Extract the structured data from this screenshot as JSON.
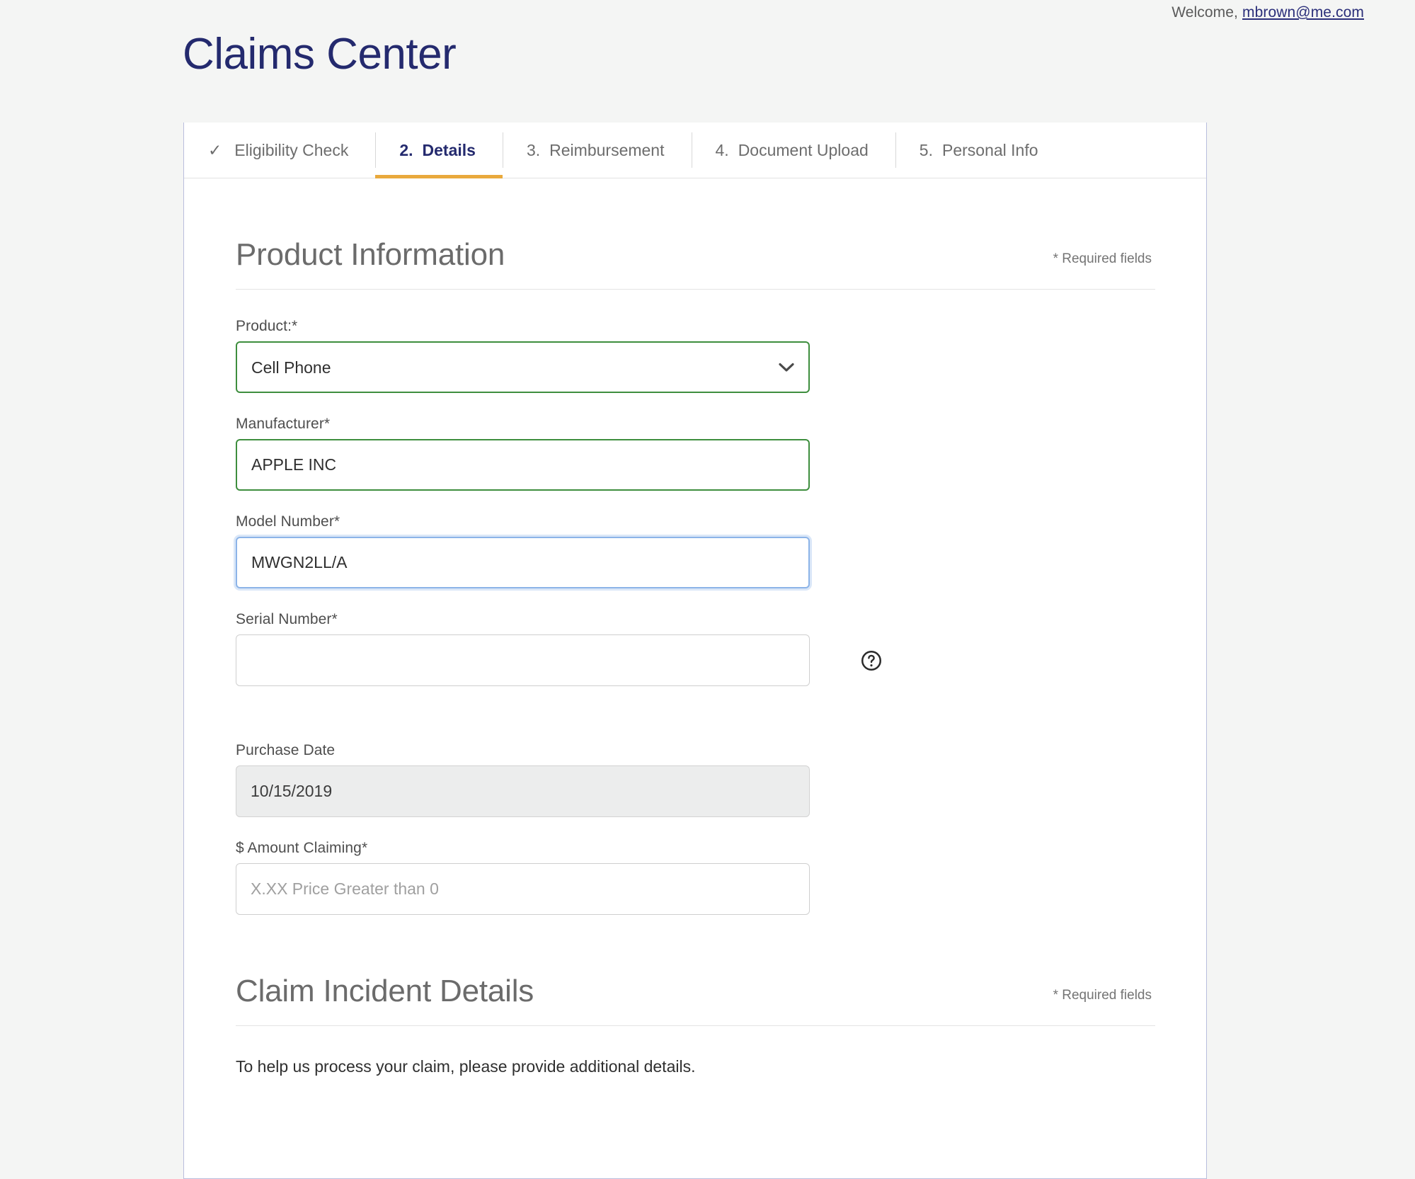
{
  "header": {
    "welcome_label": "Welcome,",
    "welcome_email": "mbrown@me.com",
    "page_title": "Claims Center"
  },
  "tabs": [
    {
      "num": "",
      "label": "Eligibility Check",
      "state": "complete",
      "check_icon": "✓"
    },
    {
      "num": "2.",
      "label": "Details",
      "state": "active"
    },
    {
      "num": "3.",
      "label": "Reimbursement",
      "state": "upcoming"
    },
    {
      "num": "4.",
      "label": "Document Upload",
      "state": "upcoming"
    },
    {
      "num": "5.",
      "label": "Personal Info",
      "state": "upcoming"
    }
  ],
  "product_section": {
    "title": "Product Information",
    "required_note": "* Required fields",
    "fields": {
      "product": {
        "label": "Product:*",
        "value": "Cell Phone",
        "options": [
          "Cell Phone"
        ]
      },
      "manufacturer": {
        "label": "Manufacturer*",
        "value": "APPLE INC"
      },
      "model_number": {
        "label": "Model Number*",
        "value": "MWGN2LL/A"
      },
      "serial_number": {
        "label": "Serial Number*",
        "value": "",
        "placeholder": ""
      },
      "purchase_date": {
        "label": "Purchase Date",
        "value": "10/15/2019"
      },
      "amount_claiming": {
        "label": "$ Amount Claiming*",
        "value": "",
        "placeholder": "X.XX Price Greater than 0"
      }
    }
  },
  "incident_section": {
    "title": "Claim Incident Details",
    "required_note": "* Required fields",
    "intro_text": "To help us process your claim, please provide additional details."
  },
  "colors": {
    "brand_navy": "#232a6d",
    "accent_gold": "#e9a93c",
    "valid_green": "#3e8e3e",
    "focus_blue": "#8cb4e8",
    "page_bg": "#f4f5f4"
  }
}
